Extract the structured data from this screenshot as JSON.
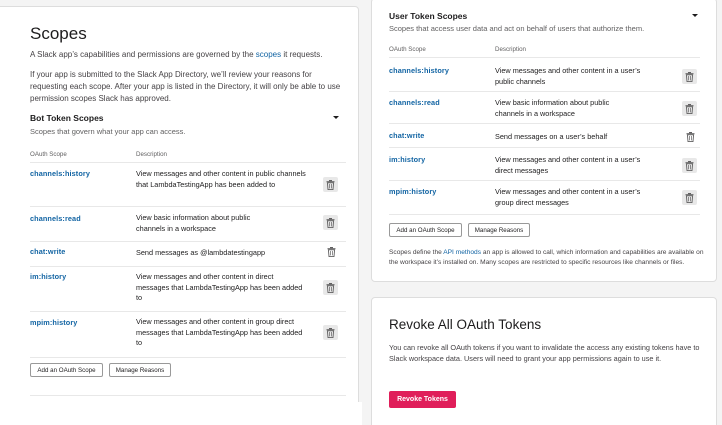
{
  "left": {
    "title": "Scopes",
    "intro_before_link": "A Slack app’s capabilities and permissions are governed by the ",
    "intro_link": "scopes",
    "intro_after_link": " it requests.",
    "review_text": "If your app is submitted to the Slack App Directory, we’ll review your reasons for requesting each scope. After your app is listed in the Directory, it will only be able to use permission scopes Slack has approved.",
    "bot_section_title": "Bot Token Scopes",
    "bot_section_subtitle": "Scopes that govern what your app can access.",
    "col_scope": "OAuth Scope",
    "col_desc": "Description",
    "rows": [
      {
        "name": "channels:history",
        "desc": "View messages and other content in public channels that LambdaTestingApp has been added to"
      },
      {
        "name": "channels:read",
        "desc": "View basic information about public channels in a workspace"
      },
      {
        "name": "chat:write",
        "desc": "Send messages as @lambdatestingapp"
      },
      {
        "name": "im:history",
        "desc": "View messages and other content in direct messages that LambdaTestingApp has been added to"
      },
      {
        "name": "mpim:history",
        "desc": "View messages and other content in group direct messages that LambdaTestingApp has been added to"
      }
    ],
    "add_button": "Add an OAuth Scope",
    "manage_button": "Manage Reasons"
  },
  "right": {
    "user_section_title": "User Token Scopes",
    "user_section_subtitle": "Scopes that access user data and act on behalf of users that authorize them.",
    "col_scope": "OAuth Scope",
    "col_desc": "Description",
    "rows": [
      {
        "name": "channels:history",
        "desc": "View messages and other content in a user’s public channels"
      },
      {
        "name": "channels:read",
        "desc": "View basic information about public channels in a workspace"
      },
      {
        "name": "chat:write",
        "desc": "Send messages on a user’s behalf"
      },
      {
        "name": "im:history",
        "desc": "View messages and other content in a user’s direct messages"
      },
      {
        "name": "mpim:history",
        "desc": "View messages and other content in a user’s group direct messages"
      }
    ],
    "add_button": "Add an OAuth Scope",
    "manage_button": "Manage Reasons",
    "footnote_before_link": "Scopes define the ",
    "footnote_link": "API methods",
    "footnote_after_link": " an app is allowed to call, which information and capabilities are available on the workspace it’s installed on. Many scopes are restricted to specific resources like channels or files."
  },
  "revoke": {
    "title": "Revoke All OAuth Tokens",
    "text": "You can revoke all OAuth tokens if you want to invalidate the access any existing tokens have to Slack workspace data. Users will need to grant your app permissions again to use it.",
    "button": "Revoke Tokens"
  },
  "icons": {
    "trash": "trash-icon",
    "caret": "caret-down-icon"
  },
  "colors": {
    "link": "#1264a3",
    "danger": "#e01e5a"
  }
}
